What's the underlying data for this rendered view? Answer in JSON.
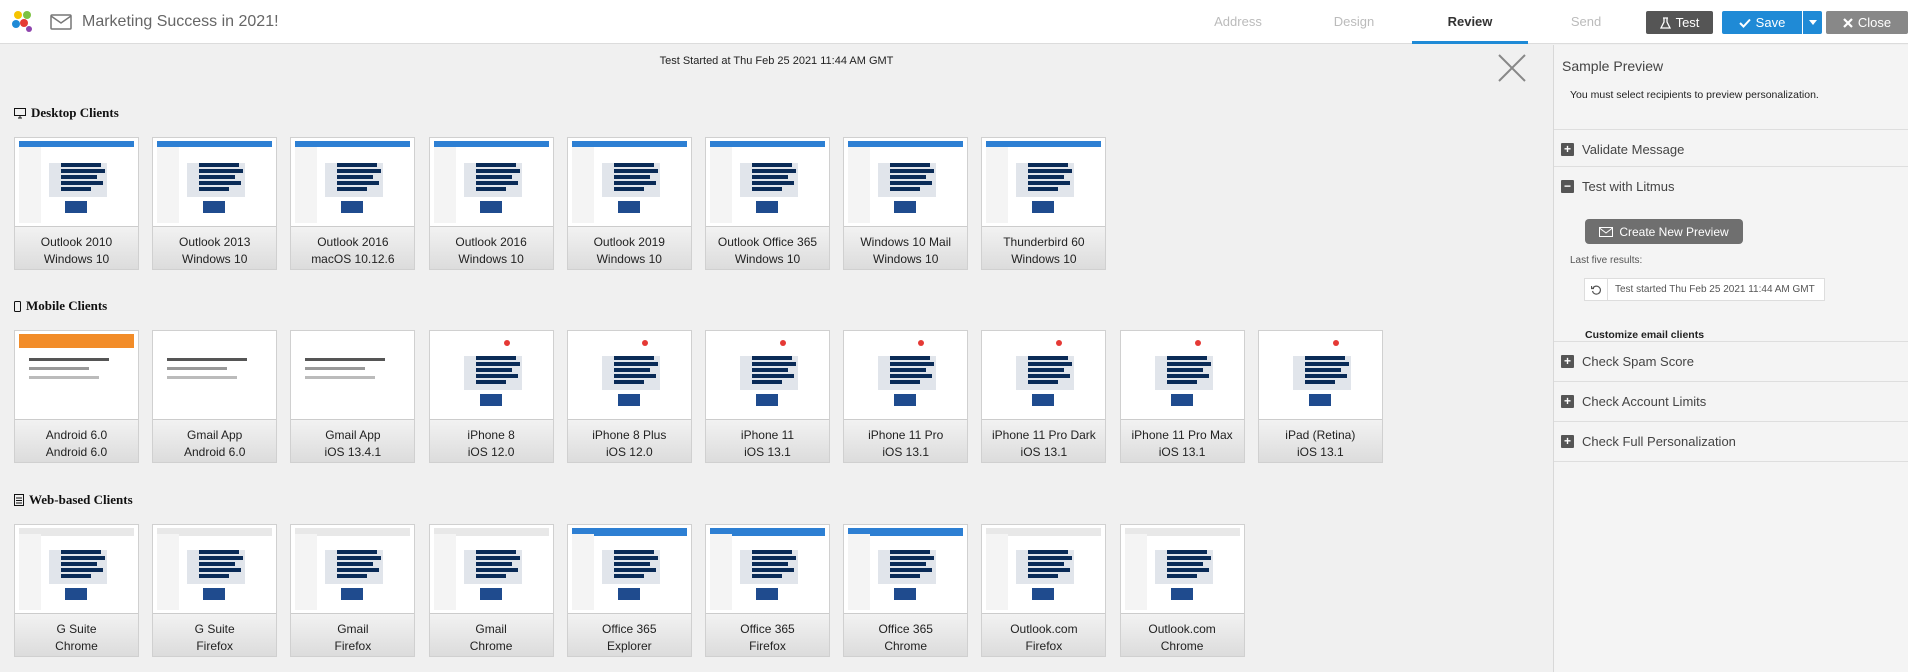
{
  "header": {
    "title": "Marketing Success in 2021!",
    "steps": [
      "Address",
      "Design",
      "Review",
      "Send"
    ],
    "active_step": "Review",
    "test_label": "Test",
    "save_label": "Save",
    "close_label": "Close"
  },
  "main": {
    "test_started": "Test Started at Thu Feb 25 2021 11:44 AM GMT",
    "sections": [
      {
        "title": "Desktop Clients",
        "icon": "monitor-icon",
        "clients": [
          {
            "name": "Outlook 2010",
            "platform": "Windows 10"
          },
          {
            "name": "Outlook 2013",
            "platform": "Windows 10"
          },
          {
            "name": "Outlook 2016",
            "platform": "macOS 10.12.6"
          },
          {
            "name": "Outlook 2016",
            "platform": "Windows 10"
          },
          {
            "name": "Outlook 2019",
            "platform": "Windows 10"
          },
          {
            "name": "Outlook Office 365",
            "platform": "Windows 10"
          },
          {
            "name": "Windows 10 Mail",
            "platform": "Windows 10"
          },
          {
            "name": "Thunderbird 60",
            "platform": "Windows 10"
          }
        ]
      },
      {
        "title": "Mobile Clients",
        "icon": "mobile-icon",
        "clients": [
          {
            "name": "Android 6.0",
            "platform": "Android 6.0"
          },
          {
            "name": "Gmail App",
            "platform": "Android 6.0"
          },
          {
            "name": "Gmail App",
            "platform": "iOS 13.4.1"
          },
          {
            "name": "iPhone 8",
            "platform": "iOS 12.0"
          },
          {
            "name": "iPhone 8 Plus",
            "platform": "iOS 12.0"
          },
          {
            "name": "iPhone 11",
            "platform": "iOS 13.1"
          },
          {
            "name": "iPhone 11 Pro",
            "platform": "iOS 13.1"
          },
          {
            "name": "iPhone 11 Pro Dark",
            "platform": "iOS 13.1"
          },
          {
            "name": "iPhone 11 Pro Max",
            "platform": "iOS 13.1"
          },
          {
            "name": "iPad (Retina)",
            "platform": "iOS 13.1"
          }
        ]
      },
      {
        "title": "Web-based Clients",
        "icon": "document-icon",
        "clients": [
          {
            "name": "G Suite",
            "platform": "Chrome"
          },
          {
            "name": "G Suite",
            "platform": "Firefox"
          },
          {
            "name": "Gmail",
            "platform": "Firefox"
          },
          {
            "name": "Gmail",
            "platform": "Chrome"
          },
          {
            "name": "Office 365",
            "platform": "Explorer"
          },
          {
            "name": "Office 365",
            "platform": "Firefox"
          },
          {
            "name": "Office 365",
            "platform": "Chrome"
          },
          {
            "name": "Outlook.com",
            "platform": "Firefox"
          },
          {
            "name": "Outlook.com",
            "platform": "Chrome"
          }
        ]
      }
    ]
  },
  "sidebar": {
    "title": "Sample Preview",
    "note": "You must select recipients to preview personalization.",
    "validate": "Validate Message",
    "litmus": "Test with Litmus",
    "create_preview": "Create New Preview",
    "last_five": "Last five results:",
    "result": "Test started Thu Feb 25 2021 11:44 AM GMT",
    "customize": "Customize email clients",
    "spam": "Check Spam Score",
    "limits": "Check Account Limits",
    "personalization": "Check Full Personalization"
  },
  "colors": {
    "accent": "#1f8ad6",
    "dark_button": "#555555",
    "close_button": "#888888"
  }
}
